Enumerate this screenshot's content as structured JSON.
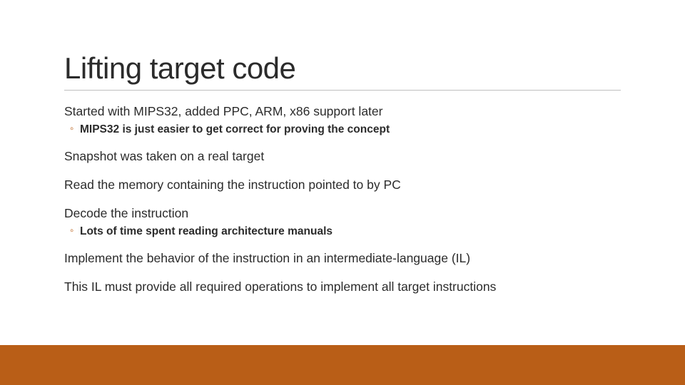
{
  "slide": {
    "title": "Lifting target code",
    "lines": {
      "l1": "Started with MIPS32, added PPC, ARM, x86 support later",
      "l1a": "MIPS32 is just easier to get correct for proving the concept",
      "l2": "Snapshot was taken on a real target",
      "l3": "Read the memory containing the instruction pointed to by PC",
      "l4": "Decode the instruction",
      "l4a": "Lots of time spent reading architecture manuals",
      "l5": "Implement the behavior of the instruction in an intermediate-language (IL)",
      "l6": "This IL must provide all required operations to implement all target instructions"
    }
  },
  "colors": {
    "accent": "#b95e17",
    "text": "#2b2b2b",
    "rule": "#bfbfbf"
  }
}
